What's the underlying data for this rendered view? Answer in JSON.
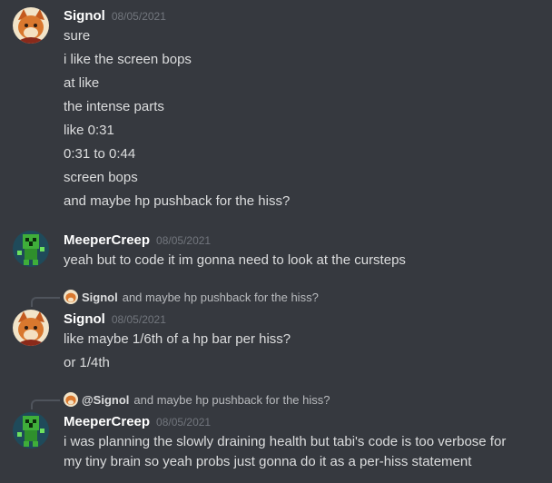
{
  "messages": [
    {
      "author": "Signol",
      "timestamp": "08/05/2021",
      "avatar_icon": "fox-avatar-icon",
      "lines": [
        "sure",
        "i like the screen bops",
        "at like",
        "the intense parts",
        "like 0:31",
        "0:31 to 0:44",
        "screen bops",
        "and maybe hp pushback for the hiss?"
      ]
    },
    {
      "author": "MeeperCreep",
      "timestamp": "08/05/2021",
      "avatar_icon": "creeper-avatar-icon",
      "lines": [
        "yeah but to code it im gonna need to look at the cursteps"
      ]
    },
    {
      "reply_to": {
        "author": "Signol",
        "text": "and maybe hp pushback for the hiss?"
      },
      "author": "Signol",
      "timestamp": "08/05/2021",
      "avatar_icon": "fox-avatar-icon",
      "lines": [
        "like maybe 1/6th of a hp bar per hiss?",
        "or 1/4th"
      ]
    },
    {
      "reply_to": {
        "author": "@Signol",
        "text": "and maybe hp pushback for the hiss?"
      },
      "author": "MeeperCreep",
      "timestamp": "08/05/2021",
      "avatar_icon": "creeper-avatar-icon",
      "lines": [
        "i was planning the slowly draining health but tabi's code is too verbose for",
        "my tiny brain so yeah probs just gonna do it as a per-hiss statement"
      ]
    }
  ],
  "colors": {
    "background": "#36393f",
    "author": "#ffffff",
    "text": "#dcddde",
    "timestamp": "#72767d"
  }
}
